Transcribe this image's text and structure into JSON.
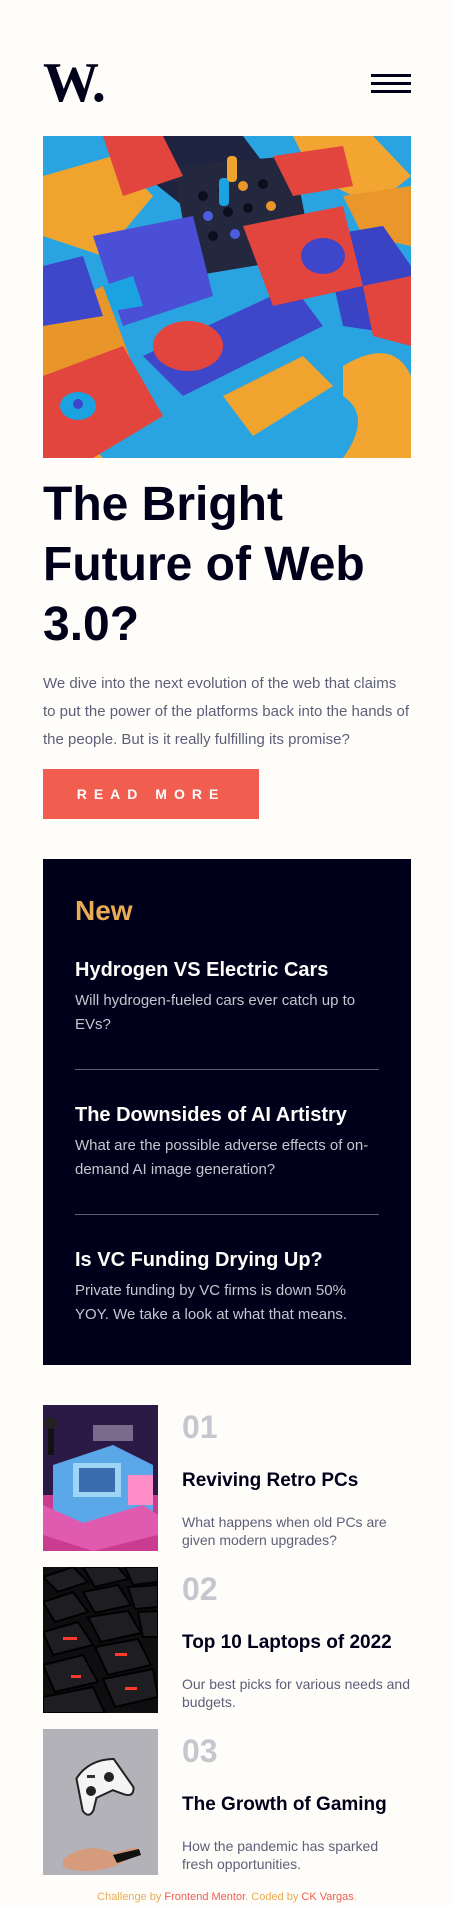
{
  "header": {
    "logo": "W.",
    "menu_icon": "hamburger-menu-icon"
  },
  "hero": {
    "image_icon": "abstract-3d-shapes-image",
    "title": "The Bright Future of Web 3.0?",
    "text": "We dive into the next evolution of the web that claims to put the power of the platforms back into the hands of the people. But is it really fulfilling its promise?",
    "button_label": "READ MORE"
  },
  "new_section": {
    "heading": "New",
    "items": [
      {
        "title": "Hydrogen VS Electric Cars",
        "desc": "Will hydrogen-fueled cars ever catch up to EVs?"
      },
      {
        "title": "The Downsides of AI Artistry",
        "desc": "What are the possible adverse effects of on-demand AI image generation?"
      },
      {
        "title": "Is VC Funding Drying Up?",
        "desc": "Private funding by VC firms is down 50% YOY. We take a look at what that means."
      }
    ]
  },
  "articles": [
    {
      "number": "01",
      "title": "Reviving Retro PCs",
      "desc": "What happens when old PCs are given modern upgrades?",
      "image": "retro-pc-image"
    },
    {
      "number": "02",
      "title": "Top 10 Laptops of 2022",
      "desc": "Our best picks for various needs and budgets.",
      "image": "laptop-keyboard-image"
    },
    {
      "number": "03",
      "title": "The Growth of Gaming",
      "desc": "How the pandemic has sparked fresh opportunities.",
      "image": "gaming-controller-image"
    }
  ],
  "attribution": {
    "prefix": "Challenge by ",
    "fm_link": "Frontend Mentor",
    "middle": ". Coded by ",
    "author_link": "CK Vargas",
    "suffix": "."
  },
  "colors": {
    "accent_red": "#f15e50",
    "accent_orange": "#e9ab53",
    "dark_navy": "#00001a",
    "off_white": "#fffdfa",
    "grayish_blue": "#5d5f79"
  }
}
